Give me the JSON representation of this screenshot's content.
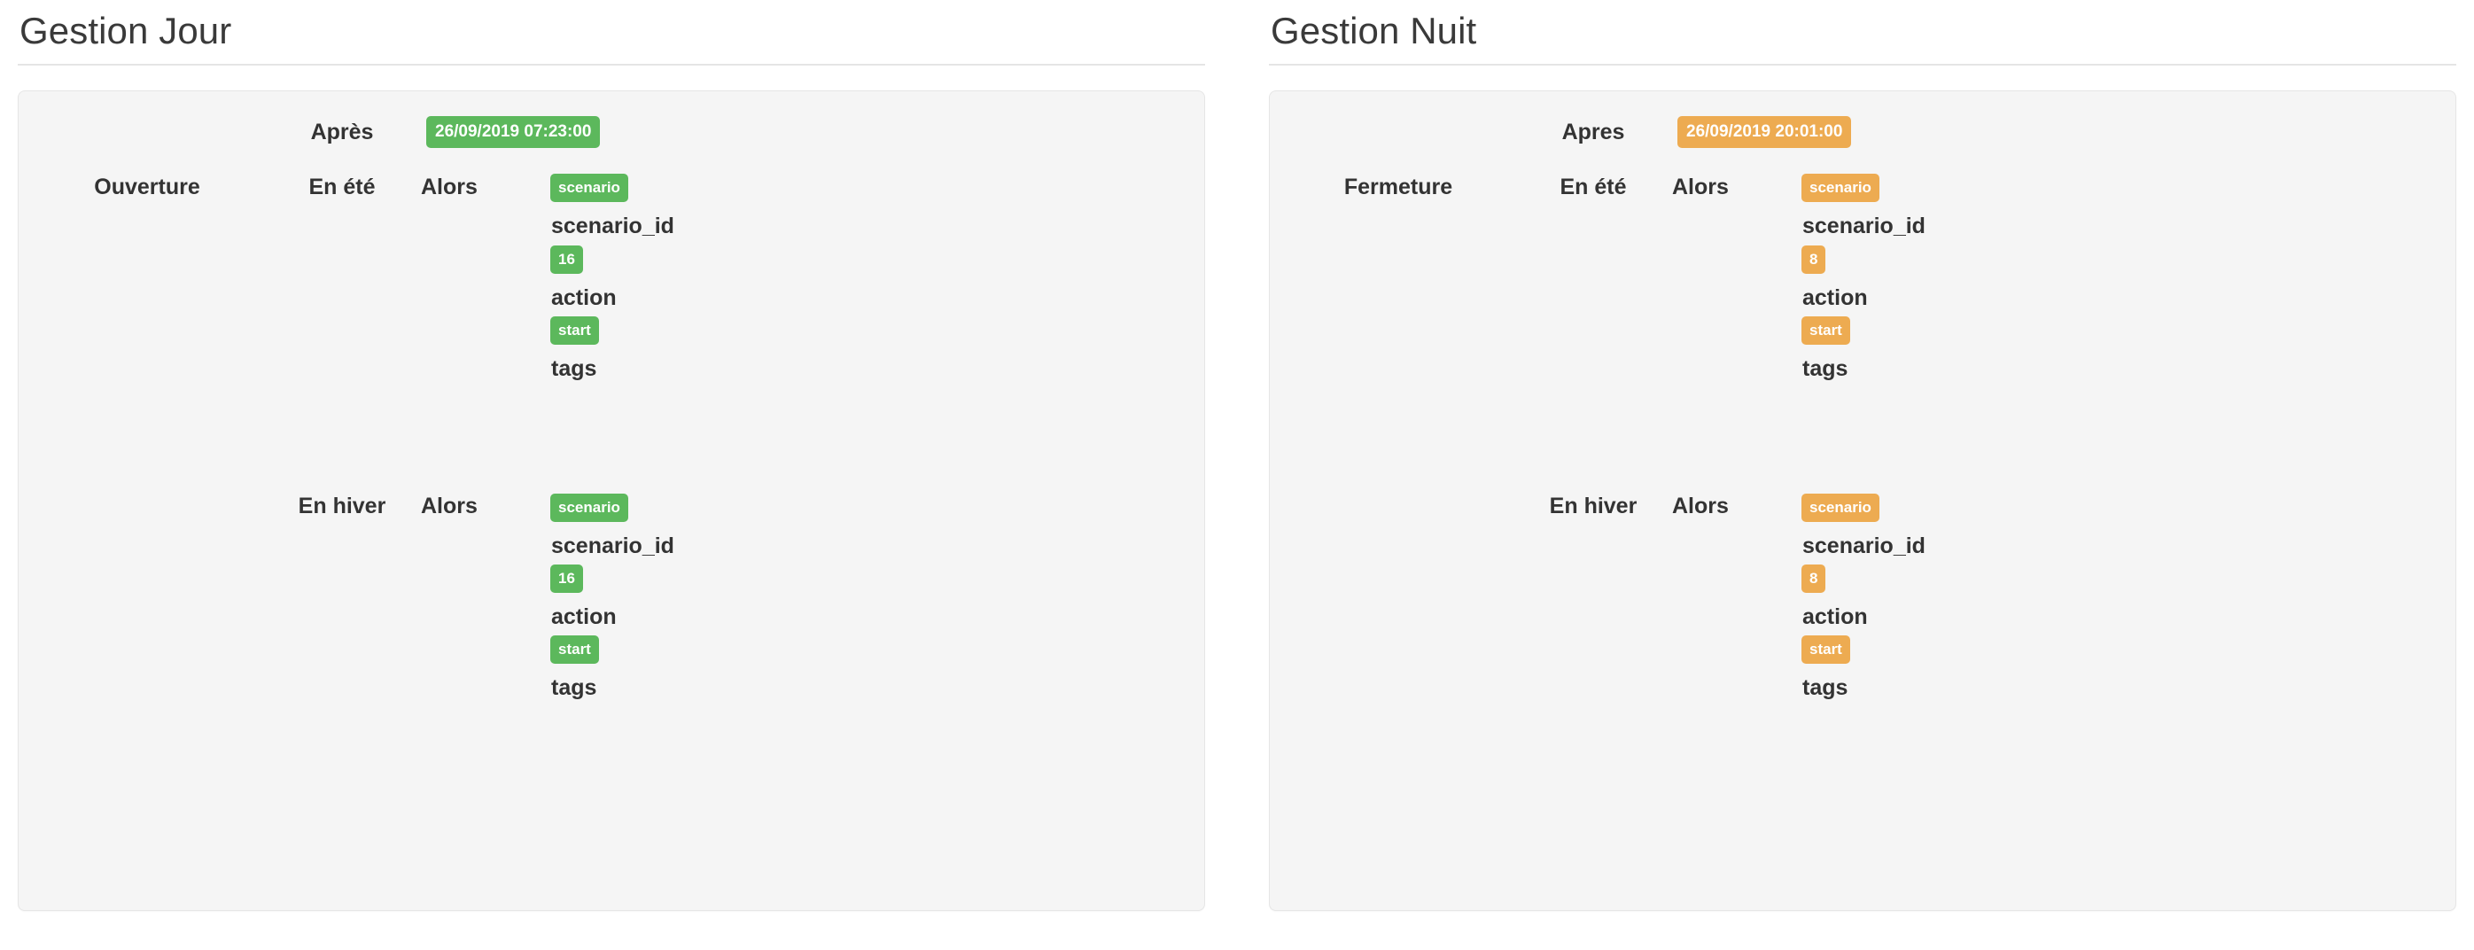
{
  "panels": [
    {
      "title": "Gestion Jour",
      "accent": "#5cb85c",
      "badge_style": "green",
      "after": {
        "label": "Après",
        "datetime": "26/09/2019 07:23:00"
      },
      "rules": [
        {
          "event": "Ouverture",
          "season": "En été",
          "then": "Alors",
          "detail": {
            "type_badge": "scenario",
            "scenario_id_key": "scenario_id",
            "scenario_id_value": "16",
            "action_key": "action",
            "action_value": "start",
            "tags_key": "tags"
          }
        },
        {
          "event": "",
          "season": "En hiver",
          "then": "Alors",
          "detail": {
            "type_badge": "scenario",
            "scenario_id_key": "scenario_id",
            "scenario_id_value": "16",
            "action_key": "action",
            "action_value": "start",
            "tags_key": "tags"
          }
        }
      ]
    },
    {
      "title": "Gestion Nuit",
      "accent": "#edab51",
      "badge_style": "orange",
      "after": {
        "label": "Apres",
        "datetime": "26/09/2019 20:01:00"
      },
      "rules": [
        {
          "event": "Fermeture",
          "season": "En été",
          "then": "Alors",
          "detail": {
            "type_badge": "scenario",
            "scenario_id_key": "scenario_id",
            "scenario_id_value": "8",
            "action_key": "action",
            "action_value": "start",
            "tags_key": "tags"
          }
        },
        {
          "event": "",
          "season": "En hiver",
          "then": "Alors",
          "detail": {
            "type_badge": "scenario",
            "scenario_id_key": "scenario_id",
            "scenario_id_value": "8",
            "action_key": "action",
            "action_value": "start",
            "tags_key": "tags"
          }
        }
      ]
    }
  ]
}
